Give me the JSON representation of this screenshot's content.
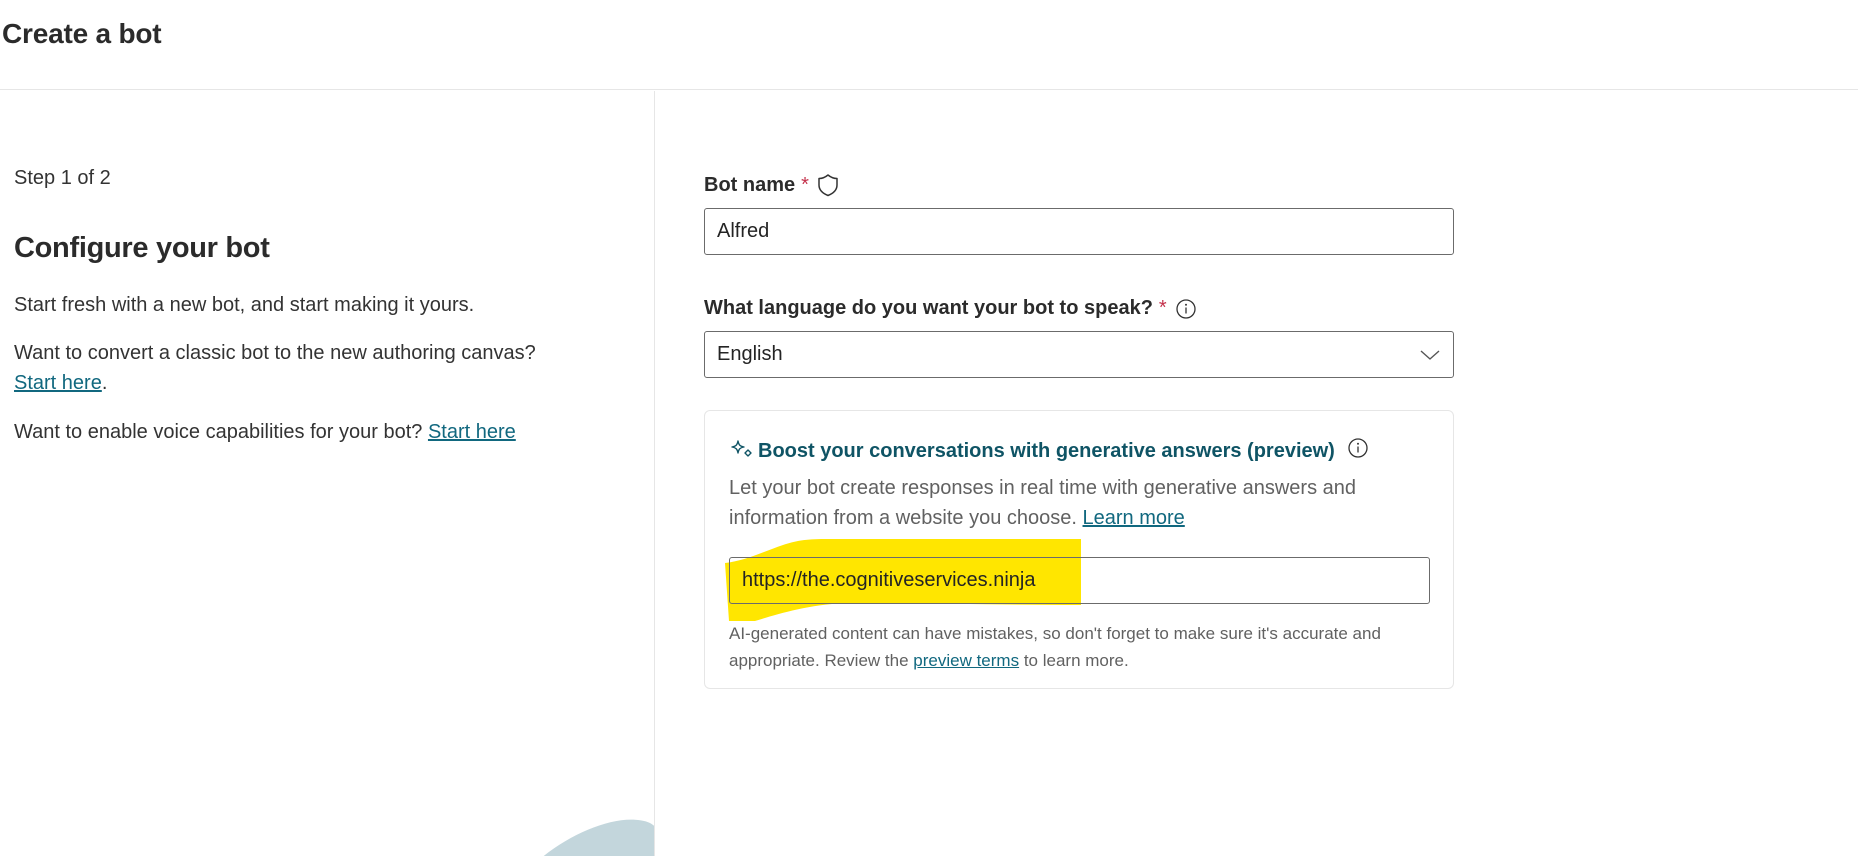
{
  "header": {
    "title": "Create a bot"
  },
  "left_panel": {
    "step": "Step 1 of 2",
    "heading": "Configure your bot",
    "intro": "Start fresh with a new bot, and start making it yours.",
    "convert_prompt": "Want to convert a classic bot to the new authoring canvas?",
    "convert_link": "Start here",
    "convert_suffix": ".",
    "voice_prompt": "Want to enable voice capabilities for your bot?",
    "voice_link": "Start here"
  },
  "form": {
    "bot_name": {
      "label": "Bot name",
      "required_mark": "*",
      "icon": "shield-icon",
      "value": "Alfred"
    },
    "language": {
      "label": "What language do you want your bot to speak?",
      "required_mark": "*",
      "icon": "info-icon",
      "selected": "English",
      "dropdown_icon": "chevron-down-icon"
    },
    "generative_card": {
      "icon": "sparkle-icon",
      "title": "Boost your conversations with generative answers (preview)",
      "info_icon": "info-icon",
      "description": "Let your bot create responses in real time with generative answers and information from a website you choose.",
      "learn_more": "Learn more",
      "url_value": "https://the.cognitiveservices.ninja",
      "disclaimer_prefix": "AI-generated content can have mistakes, so don't forget to make sure it's accurate and appropriate. Review the",
      "preview_terms_link": "preview terms",
      "disclaimer_suffix": "to learn more."
    }
  },
  "colors": {
    "link": "#11687f",
    "card_title": "#0f5465",
    "required": "#c4314b",
    "highlight": "#ffe600",
    "decorative_shape": "#c3d6dc"
  }
}
